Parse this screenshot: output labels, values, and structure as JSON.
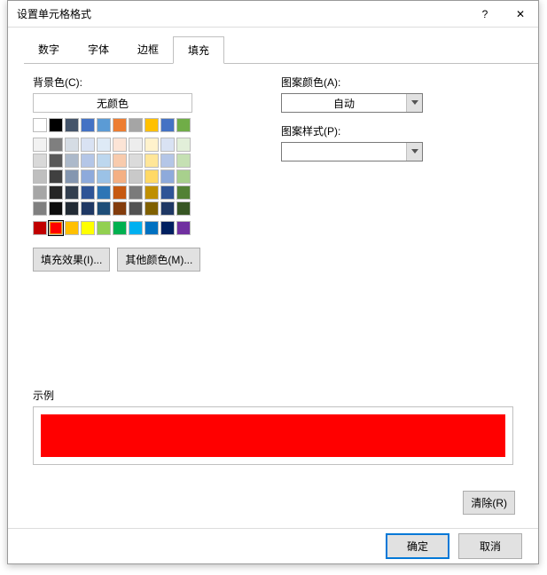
{
  "dialog": {
    "title": "设置单元格格式",
    "help": "?",
    "close": "✕"
  },
  "tabs": [
    "数字",
    "字体",
    "边框",
    "填充"
  ],
  "activeTab": 3,
  "labels": {
    "bgColor": "背景色(C):",
    "noColor": "无颜色",
    "patternColor": "图案颜色(A):",
    "patternStyle": "图案样式(P):",
    "auto": "自动",
    "fillEffects": "填充效果(I)...",
    "moreColors": "其他颜色(M)...",
    "sample": "示例",
    "clear": "清除(R)",
    "ok": "确定",
    "cancel": "取消"
  },
  "dropdowns": {
    "patternColor": "自动",
    "patternStyle": ""
  },
  "themeRow": [
    "#ffffff",
    "#000000",
    "#44546a",
    "#4472c4",
    "#5b9bd5",
    "#ed7d31",
    "#a5a5a5",
    "#ffc000",
    "#4472c4",
    "#70ad47"
  ],
  "shadeRows": [
    [
      "#f2f2f2",
      "#7f7f7f",
      "#d5dce4",
      "#d9e2f3",
      "#deeaf6",
      "#fce4d6",
      "#ededed",
      "#fff2cc",
      "#d9e2f3",
      "#e2efd9"
    ],
    [
      "#d9d9d9",
      "#595959",
      "#acb9ca",
      "#b4c6e7",
      "#bdd7ee",
      "#f8cbad",
      "#dbdbdb",
      "#ffe699",
      "#b4c6e7",
      "#c5e0b3"
    ],
    [
      "#bfbfbf",
      "#404040",
      "#8496b0",
      "#8eaadb",
      "#9bc2e6",
      "#f4b084",
      "#c9c9c9",
      "#ffd966",
      "#8eaadb",
      "#a8d08d"
    ],
    [
      "#a6a6a6",
      "#262626",
      "#333f4f",
      "#2f5496",
      "#2e75b5",
      "#c65911",
      "#7b7b7b",
      "#bf8f00",
      "#2f5496",
      "#538135"
    ],
    [
      "#808080",
      "#0d0d0d",
      "#222b35",
      "#1f3864",
      "#1f4e78",
      "#833c0c",
      "#525252",
      "#806000",
      "#1f3864",
      "#375623"
    ]
  ],
  "standardColors": [
    "#c00000",
    "#ff0000",
    "#ffc000",
    "#ffff00",
    "#92d050",
    "#00b050",
    "#00b0f0",
    "#0070c0",
    "#002060",
    "#7030a0"
  ],
  "selectedColor": "#ff0000",
  "sampleColor": "#ff0000"
}
